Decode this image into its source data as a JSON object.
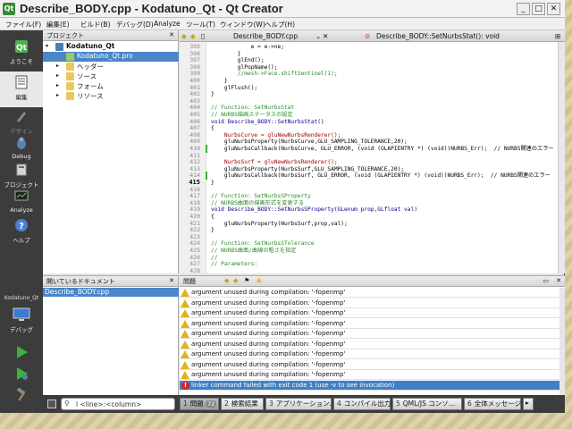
{
  "window": {
    "title": "Describe_BODY.cpp - Kodatuno_Qt - Qt Creator",
    "app_icon_letter": "Qt"
  },
  "menu": [
    "ファイル(F)",
    "編集(E)",
    "ビルド(B)",
    "デバッグ(D)",
    "Analyze",
    "ツール(T)",
    "ウィンドウ(W)",
    "ヘルプ(H)"
  ],
  "modes": {
    "welcome": "ようこそ",
    "edit": "編集",
    "design": "デザイン",
    "debug": "Debug",
    "projects": "プロジェクト",
    "analyze": "Analyze",
    "help": "ヘルプ",
    "kit_name": "Kodatuno_Qt",
    "kit_label": "デバッグ"
  },
  "project_panel": {
    "header": "プロジェクト",
    "items": [
      {
        "label": "Kodatuno_Qt",
        "arrow": "▾",
        "icon": "project-icon"
      },
      {
        "label": "Kodatuno_Qt.pro",
        "arrow": "",
        "icon": "pro-file-icon"
      },
      {
        "label": "ヘッダー",
        "arrow": "▸",
        "icon": "folder-icon"
      },
      {
        "label": "ソース",
        "arrow": "▸",
        "icon": "folder-icon"
      },
      {
        "label": "フォーム",
        "arrow": "▸",
        "icon": "folder-icon"
      },
      {
        "label": "リソース",
        "arrow": "▸",
        "icon": "folder-icon"
      }
    ]
  },
  "open_docs": {
    "header": "開いているドキュメント",
    "items": [
      "Describe_BODY.cpp"
    ]
  },
  "editor": {
    "file_tab": "Describe_BODY.cpp",
    "function_tab": "Describe_BODY::SetNurbsStat(): void",
    "line_numbers": [
      "395",
      "396",
      "397",
      "398",
      "399",
      "400",
      "401",
      "402",
      "403",
      "404",
      "405",
      "406",
      "407",
      "408",
      "409",
      "410",
      "411",
      "412",
      "413",
      "414",
      "415",
      "416",
      "417",
      "418",
      "419",
      "420",
      "421",
      "422",
      "423",
      "424",
      "425",
      "426",
      "427",
      "428"
    ],
    "current_line": "415",
    "lines": [
      {
        "t": "            e = e->ne;",
        "k": ""
      },
      {
        "t": "        }",
        "k": ""
      },
      {
        "t": "        glEnd();",
        "k": ""
      },
      {
        "t": "        glPopName();",
        "k": ""
      },
      {
        "t": "        //mesh->Face.shiftSentinel(1);",
        "k": "cm"
      },
      {
        "t": "    }",
        "k": ""
      },
      {
        "t": "    glFlush();",
        "k": ""
      },
      {
        "t": "}",
        "k": ""
      },
      {
        "t": "",
        "k": ""
      },
      {
        "t": "// Function: SetNurbsStat",
        "k": "cm"
      },
      {
        "t": "// NURBS描画ステータスの設定",
        "k": "cm"
      },
      {
        "t": "void Describe_BODY::SetNurbsStat()",
        "k": "fn"
      },
      {
        "t": "{",
        "k": ""
      },
      {
        "t": "    NurbsCurve = gluNewNurbsRenderer();",
        "k": "rd"
      },
      {
        "t": "    gluNurbsProperty(NurbsCurve,GLU_SAMPLING_TOLERANCE,20);",
        "k": ""
      },
      {
        "t": "    gluNurbsCallback(NurbsCurve, GLU_ERROR, (void (GLAPIENTRY *) (void))NURBS_Err);  // NURBS関連のエラー",
        "k": ""
      },
      {
        "t": "",
        "k": ""
      },
      {
        "t": "    NurbsSurf = gluNewNurbsRenderer();",
        "k": "rd"
      },
      {
        "t": "    gluNurbsProperty(NurbsSurf,GLU_SAMPLING_TOLERANCE,20);",
        "k": ""
      },
      {
        "t": "    gluNurbsCallback(NurbsSurf, GLU_ERROR, (void (GLAPIENTRY *) (void))NURBS_Err);  // NURBS関連のエラー",
        "k": ""
      },
      {
        "t": "}",
        "k": ""
      },
      {
        "t": "",
        "k": ""
      },
      {
        "t": "// Function: SetNurbsSProperty",
        "k": "cm"
      },
      {
        "t": "// NURBS曲面の描画形式を変更する",
        "k": "cm"
      },
      {
        "t": "void Describe_BODY::SetNurbsSProperty(GLenum prop,GLfloat val)",
        "k": "fn"
      },
      {
        "t": "{",
        "k": ""
      },
      {
        "t": "    gluNurbsProperty(NurbsSurf,prop,val);",
        "k": ""
      },
      {
        "t": "}",
        "k": ""
      },
      {
        "t": "",
        "k": ""
      },
      {
        "t": "// Function: SetNurbsSTolerance",
        "k": "cm"
      },
      {
        "t": "// NURBS曲面/曲線の粗さを指定",
        "k": "cm"
      },
      {
        "t": "//",
        "k": "cm"
      },
      {
        "t": "// Parameters:",
        "k": "cm"
      },
      {
        "t": "",
        "k": ""
      }
    ]
  },
  "issues": {
    "header": "問題",
    "rows": [
      {
        "text": "argument unused during compilation: '-fopenmp'",
        "kind": "warning"
      },
      {
        "text": "argument unused during compilation: '-fopenmp'",
        "kind": "warning"
      },
      {
        "text": "argument unused during compilation: '-fopenmp'",
        "kind": "warning"
      },
      {
        "text": "argument unused during compilation: '-fopenmp'",
        "kind": "warning"
      },
      {
        "text": "argument unused during compilation: '-fopenmp'",
        "kind": "warning"
      },
      {
        "text": "argument unused during compilation: '-fopenmp'",
        "kind": "warning"
      },
      {
        "text": "argument unused during compilation: '-fopenmp'",
        "kind": "warning"
      },
      {
        "text": "argument unused during compilation: '-fopenmp'",
        "kind": "warning"
      },
      {
        "text": "argument unused during compilation: '-fopenmp'",
        "kind": "warning"
      },
      {
        "text": "linker command failed with exit code 1 (use -v to see invocation)",
        "kind": "error"
      }
    ]
  },
  "statusbar": {
    "locator_placeholder": "l <line>:<column>",
    "panes": [
      {
        "num": "1",
        "label": "問題",
        "badge": "72"
      },
      {
        "num": "2",
        "label": "検索結果",
        "badge": ""
      },
      {
        "num": "3",
        "label": "アプリケーション…",
        "badge": ""
      },
      {
        "num": "4",
        "label": "コンパイル出力",
        "badge": ""
      },
      {
        "num": "5",
        "label": "QML/JS コンソ…",
        "badge": ""
      },
      {
        "num": "6",
        "label": "全体メッセージ",
        "badge": ""
      }
    ]
  },
  "colors": {
    "selection": "#4a86c8",
    "warning": "#e2b21c",
    "error": "#d22222",
    "modebar": "#3c3c3c",
    "comment": "#2a8a2a"
  }
}
